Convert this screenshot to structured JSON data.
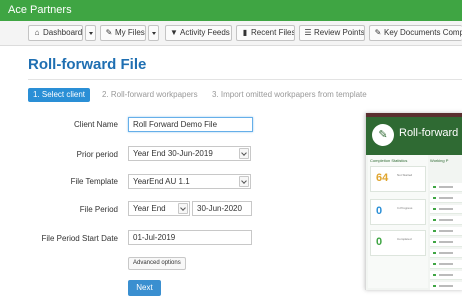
{
  "app": {
    "brand": "Ace Partners"
  },
  "toolbar": {
    "dashboard": "Dashboard",
    "my_files": "My Files",
    "activity_feeds": "Activity Feeds",
    "recent_files": "Recent Files",
    "review_points": "Review Points",
    "key_documents": "Key Documents Comp"
  },
  "page": {
    "title": "Roll-forward File"
  },
  "steps": [
    "1. Select client",
    "2. Roll-forward workpapers",
    "3. Import omitted workpapers from template"
  ],
  "form": {
    "client_name_label": "Client Name",
    "client_name_value": "Roll Forward Demo File",
    "prior_period_label": "Prior period",
    "prior_period_value": "Year End 30-Jun-2019",
    "file_template_label": "File Template",
    "file_template_value": "YearEnd AU 1.1",
    "file_period_label": "File Period",
    "file_period_type": "Year End",
    "file_period_date": "30-Jun-2020",
    "start_date_label": "File Period Start Date",
    "start_date_value": "01-Jul-2019",
    "advanced_label": "Advanced options",
    "next_label": "Next"
  },
  "preview": {
    "title": "Roll-forward",
    "left_heading": "Completion Statistics",
    "right_heading": "Working P",
    "cards": [
      {
        "value": "64",
        "caption": "Not Started",
        "color": "#e0a52d"
      },
      {
        "value": "0",
        "caption": "In Progress",
        "color": "#2a8fd6"
      },
      {
        "value": "0",
        "caption": "Completed",
        "color": "#3fa543"
      }
    ]
  },
  "icons": {
    "dashboard": "home-icon",
    "my_files": "edit-icon",
    "activity_feeds": "filter-icon",
    "recent_files": "document-icon",
    "review_points": "list-icon",
    "key_documents": "edit-icon"
  },
  "colors": {
    "appbar": "#3fa543",
    "accent": "#2a8fd6",
    "title": "#1f6fb2"
  }
}
